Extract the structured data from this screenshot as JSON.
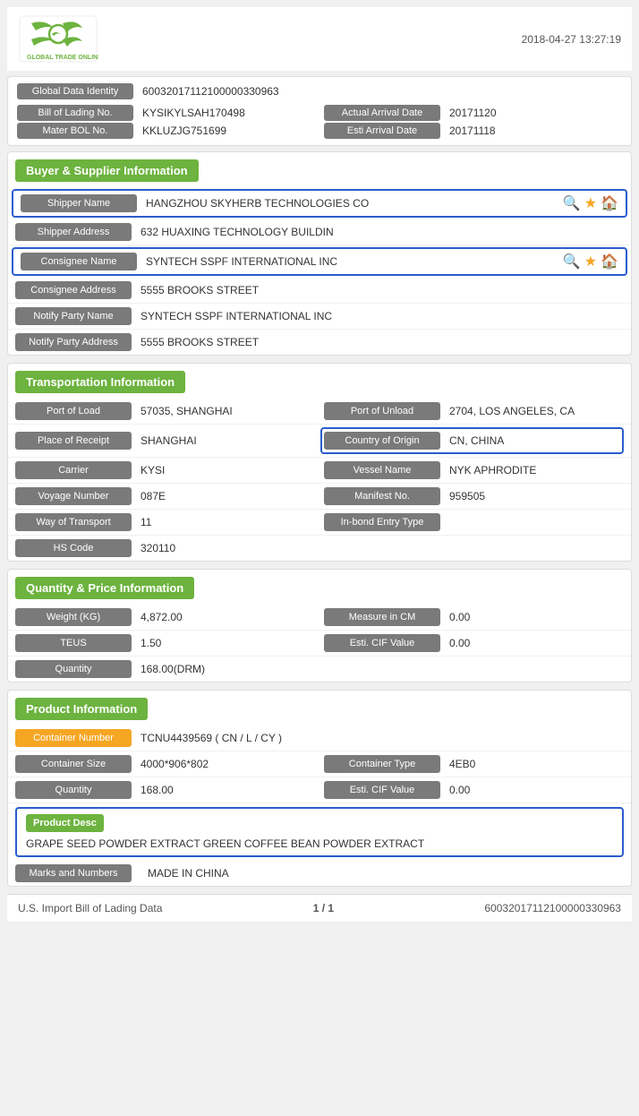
{
  "header": {
    "datetime": "2018-04-27 13:27:19"
  },
  "identity": {
    "global_data_label": "Global Data Identity",
    "global_data_value": "60032017112100000330963",
    "bill_of_lading_label": "Bill of Lading No.",
    "bill_of_lading_value": "KYSIKYLSAH170498",
    "actual_arrival_label": "Actual Arrival Date",
    "actual_arrival_value": "20171120",
    "mater_bol_label": "Mater BOL No.",
    "mater_bol_value": "KKLUZJG751699",
    "esti_arrival_label": "Esti Arrival Date",
    "esti_arrival_value": "20171118"
  },
  "buyer_supplier": {
    "section_title": "Buyer & Supplier Information",
    "shipper_name_label": "Shipper Name",
    "shipper_name_value": "HANGZHOU SKYHERB TECHNOLOGIES CO",
    "shipper_address_label": "Shipper Address",
    "shipper_address_value": "632 HUAXING TECHNOLOGY BUILDIN",
    "consignee_name_label": "Consignee Name",
    "consignee_name_value": "SYNTECH SSPF INTERNATIONAL INC",
    "consignee_address_label": "Consignee Address",
    "consignee_address_value": "5555 BROOKS STREET",
    "notify_party_name_label": "Notify Party Name",
    "notify_party_name_value": "SYNTECH SSPF INTERNATIONAL INC",
    "notify_party_address_label": "Notify Party Address",
    "notify_party_address_value": "5555 BROOKS STREET"
  },
  "transportation": {
    "section_title": "Transportation Information",
    "port_of_load_label": "Port of Load",
    "port_of_load_value": "57035, SHANGHAI",
    "port_of_unload_label": "Port of Unload",
    "port_of_unload_value": "2704, LOS ANGELES, CA",
    "place_of_receipt_label": "Place of Receipt",
    "place_of_receipt_value": "SHANGHAI",
    "country_of_origin_label": "Country of Origin",
    "country_of_origin_value": "CN, CHINA",
    "carrier_label": "Carrier",
    "carrier_value": "KYSI",
    "vessel_name_label": "Vessel Name",
    "vessel_name_value": "NYK APHRODITE",
    "voyage_number_label": "Voyage Number",
    "voyage_number_value": "087E",
    "manifest_no_label": "Manifest No.",
    "manifest_no_value": "959505",
    "way_of_transport_label": "Way of Transport",
    "way_of_transport_value": "11",
    "inbond_entry_label": "In-bond Entry Type",
    "inbond_entry_value": "",
    "hs_code_label": "HS Code",
    "hs_code_value": "320110"
  },
  "quantity_price": {
    "section_title": "Quantity & Price Information",
    "weight_label": "Weight (KG)",
    "weight_value": "4,872.00",
    "measure_in_cm_label": "Measure in CM",
    "measure_in_cm_value": "0.00",
    "teus_label": "TEUS",
    "teus_value": "1.50",
    "esti_cif_label": "Esti. CIF Value",
    "esti_cif_value": "0.00",
    "quantity_label": "Quantity",
    "quantity_value": "168.00(DRM)"
  },
  "product_info": {
    "section_title": "Product Information",
    "container_number_label": "Container Number",
    "container_number_value": "TCNU4439569 ( CN / L / CY )",
    "container_size_label": "Container Size",
    "container_size_value": "4000*906*802",
    "container_type_label": "Container Type",
    "container_type_value": "4EB0",
    "quantity_label": "Quantity",
    "quantity_value": "168.00",
    "esti_cif_label": "Esti. CIF Value",
    "esti_cif_value": "0.00",
    "product_desc_label": "Product Desc",
    "product_desc_value": "GRAPE SEED POWDER EXTRACT GREEN COFFEE BEAN POWDER EXTRACT",
    "marks_and_numbers_label": "Marks and Numbers",
    "marks_and_numbers_value": "MADE IN CHINA"
  },
  "footer": {
    "left": "U.S. Import Bill of Lading Data",
    "center": "1 / 1",
    "right": "60032017112100000330963"
  }
}
